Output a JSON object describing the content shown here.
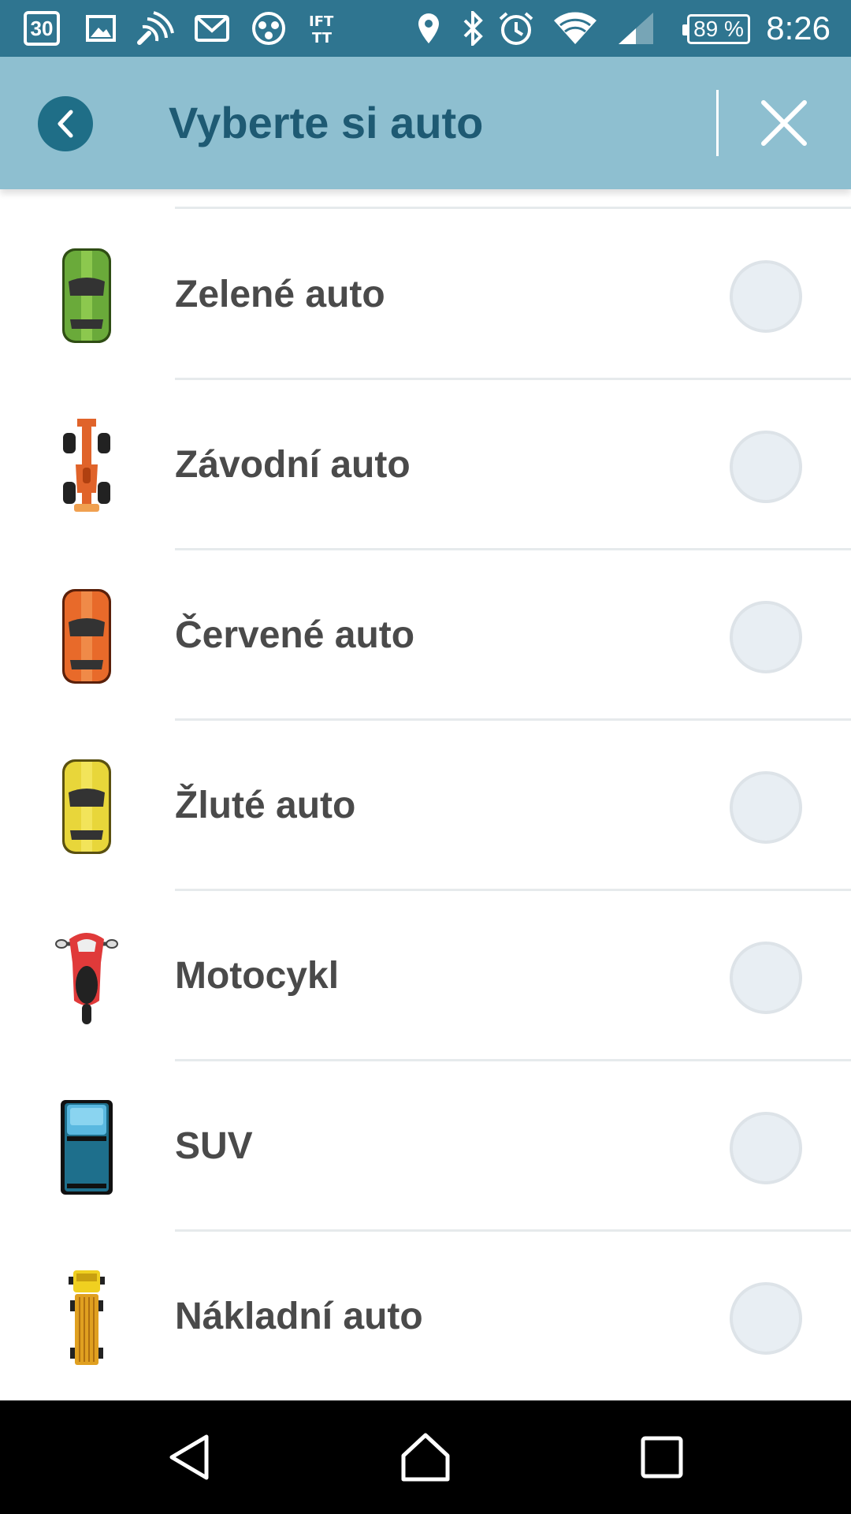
{
  "status_bar": {
    "calendar_day": "30",
    "ifttt": "IFT\nTT",
    "battery": "89 %",
    "time": "8:26",
    "icons": [
      "calendar-icon",
      "image-icon",
      "cast-icon",
      "mail-icon",
      "dots-icon",
      "ifttt-icon",
      "location-icon",
      "bluetooth-icon",
      "alarm-icon",
      "wifi-icon",
      "signal-icon",
      "battery-icon"
    ]
  },
  "header": {
    "title": "Vyberte si auto",
    "back_icon": "chevron-left-icon",
    "close_icon": "close-icon",
    "colors": {
      "background": "#8ebfd0",
      "title": "#1e5a73",
      "back_button": "#1f6e87"
    }
  },
  "vehicles": [
    {
      "label": "Zelené auto",
      "icon": "green-car-icon",
      "color": "#6aaa3a",
      "selected": false
    },
    {
      "label": "Závodní auto",
      "icon": "race-car-icon",
      "color": "#e0632a",
      "selected": false
    },
    {
      "label": "Červené auto",
      "icon": "red-car-icon",
      "color": "#e86a2a",
      "selected": false
    },
    {
      "label": "Žluté auto",
      "icon": "yellow-car-icon",
      "color": "#e8d63a",
      "selected": false
    },
    {
      "label": "Motocykl",
      "icon": "motorcycle-icon",
      "color": "#e03a3a",
      "selected": false
    },
    {
      "label": "SUV",
      "icon": "suv-icon",
      "color": "#1e6f8c",
      "selected": false
    },
    {
      "label": "Nákladní auto",
      "icon": "truck-icon",
      "color": "#e0a020",
      "selected": false
    }
  ],
  "nav_bar": {
    "icons": [
      "nav-back-icon",
      "nav-home-icon",
      "nav-recent-icon"
    ]
  }
}
